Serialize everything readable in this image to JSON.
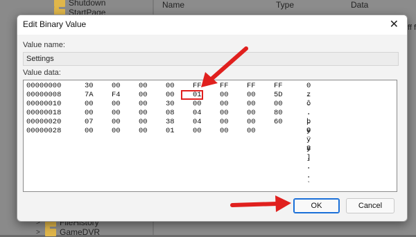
{
  "background": {
    "tree_items": [
      "Shutdown",
      "StartPage",
      "FileHistory",
      "GameDVR"
    ],
    "columns": [
      "Name",
      "Type",
      "Data"
    ],
    "peek_text": "ff ff f"
  },
  "dialog": {
    "title": "Edit Binary Value",
    "value_name_label": "Value name:",
    "value_name": "Settings",
    "value_data_label": "Value data:",
    "rows": [
      {
        "offset": "00000000",
        "bytes": [
          "30",
          "00",
          "00",
          "00",
          "FF",
          "FF",
          "FF",
          "FF"
        ],
        "ascii": "0 . . . þ ÿ ÿ ÿ"
      },
      {
        "offset": "00000008",
        "bytes": [
          "7A",
          "F4",
          "00",
          "00",
          "01",
          "00",
          "00",
          "5D"
        ],
        "ascii": "z ô . . . . . ]"
      },
      {
        "offset": "00000010",
        "bytes": [
          "00",
          "00",
          "00",
          "30",
          "00",
          "00",
          "00",
          "00"
        ],
        "ascii": ". . . 0 . . . ."
      },
      {
        "offset": "00000018",
        "bytes": [
          "00",
          "00",
          "00",
          "08",
          "04",
          "00",
          "00",
          "80"
        ],
        "ascii": ". . . . . . . ."
      },
      {
        "offset": "00000020",
        "bytes": [
          "07",
          "00",
          "00",
          "38",
          "04",
          "00",
          "00",
          "60"
        ],
        "ascii": ". . . 8 . . . `"
      },
      {
        "offset": "00000028",
        "bytes": [
          "00",
          "00",
          "00",
          "01",
          "00",
          "00",
          "00"
        ],
        "ascii": ""
      }
    ],
    "highlighted_byte": "01",
    "ok_label": "OK",
    "cancel_label": "Cancel",
    "close_icon": "close-icon"
  },
  "colors": {
    "highlight": "#e0201e",
    "ok_border": "#1a6fd8"
  }
}
